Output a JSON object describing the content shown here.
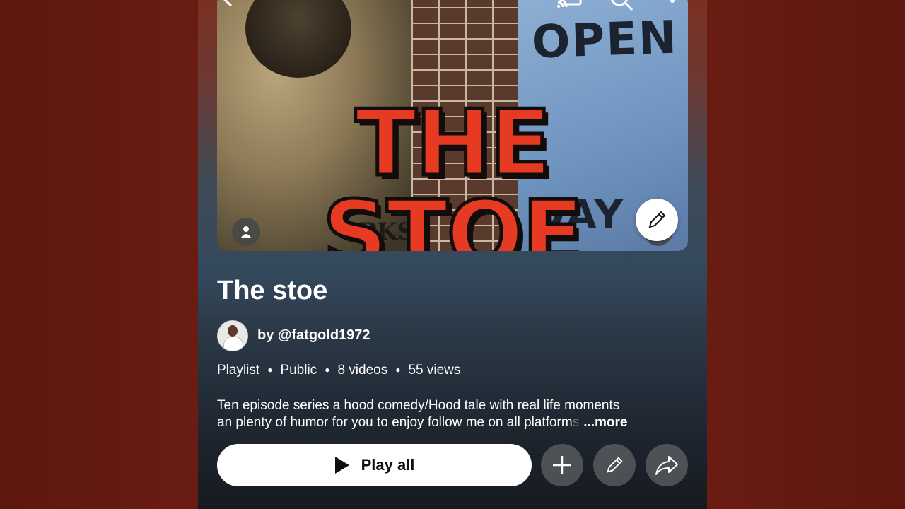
{
  "playlist": {
    "thumbnail_title": "THE STOE",
    "thumbnail_wall_text_top": "OPEN",
    "thumbnail_wall_text_bottom": "DAY",
    "thumbnail_tag": "PKS",
    "title": "The stoe",
    "owner": "by @fatgold1972",
    "meta": {
      "type": "Playlist",
      "visibility": "Public",
      "video_count": "8 videos",
      "views": "55 views"
    },
    "description_line1": "Ten episode series a hood comedy/Hood tale with real life moments",
    "description_line2": "an plenty of humor for you to enjoy follow me on all platform",
    "description_fade": "s",
    "more_label": "...more"
  },
  "actions": {
    "play_all_label": "Play all"
  },
  "icons": {
    "cast": "cast-icon",
    "search": "search-icon",
    "more": "more-vert-icon",
    "edit": "pencil-icon",
    "add": "plus-icon",
    "share": "share-icon",
    "play": "play-icon",
    "person": "person-icon",
    "mute": "mute-icon"
  },
  "colors": {
    "title_red": "#e63a22",
    "background_maroon": "#5a170f",
    "play_button_bg": "#ffffff"
  }
}
